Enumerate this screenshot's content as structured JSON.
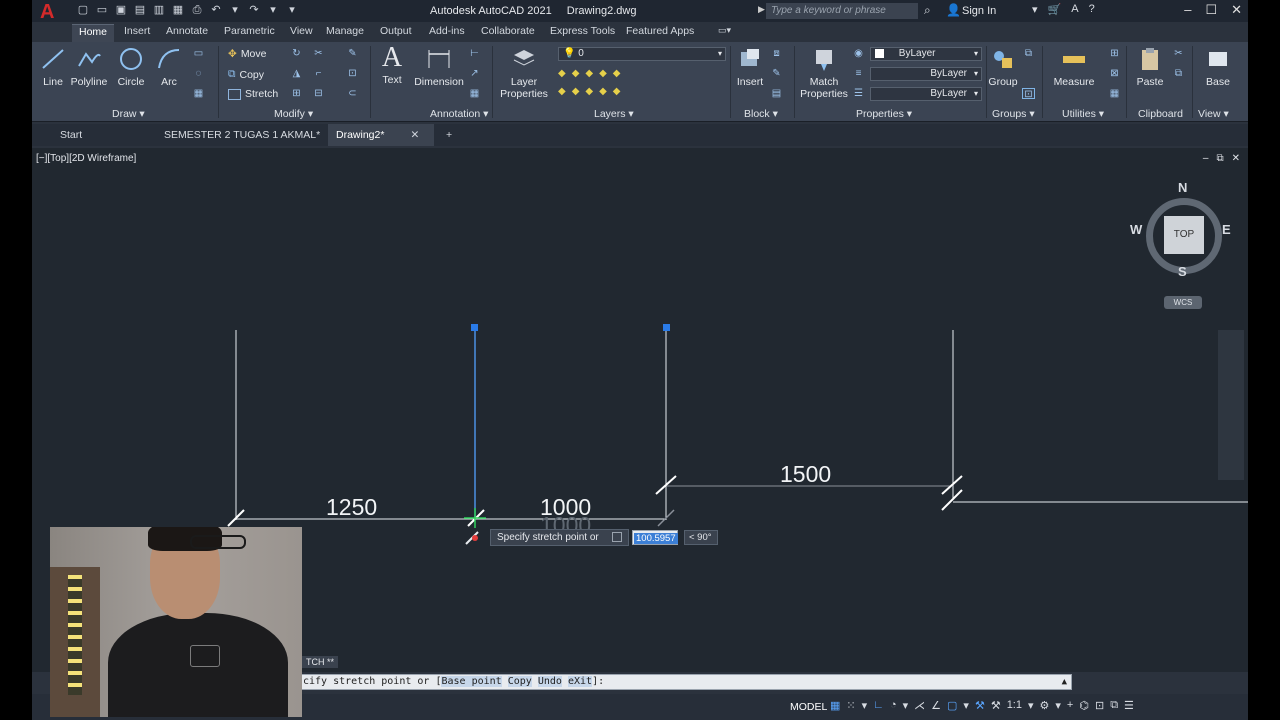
{
  "titlebar": {
    "app_name": "Autodesk AutoCAD 2021",
    "file_name": "Drawing2.dwg",
    "search_placeholder": "Type a keyword or phrase",
    "signin": "Sign In"
  },
  "ribbon_tabs": [
    "Home",
    "Insert",
    "Annotate",
    "Parametric",
    "View",
    "Manage",
    "Output",
    "Add-ins",
    "Collaborate",
    "Express Tools",
    "Featured Apps"
  ],
  "draw_panel": {
    "title": "Draw",
    "line": "Line",
    "polyline": "Polyline",
    "circle": "Circle",
    "arc": "Arc"
  },
  "modify_panel": {
    "title": "Modify",
    "move": "Move",
    "copy": "Copy",
    "stretch": "Stretch"
  },
  "annotation_panel": {
    "title": "Annotation",
    "text": "Text",
    "dimension": "Dimension"
  },
  "layers_panel": {
    "title": "Layers",
    "layer_properties_1": "Layer",
    "layer_properties_2": "Properties",
    "layer_value": "0"
  },
  "block_panel": {
    "title": "Block",
    "insert": "Insert"
  },
  "properties_panel": {
    "title": "Properties",
    "match_1": "Match",
    "match_2": "Properties",
    "color": "ByLayer",
    "linetype": "ByLayer",
    "lineweight": "ByLayer"
  },
  "groups_panel": {
    "title": "Groups",
    "group": "Group"
  },
  "utilities_panel": {
    "title": "Utilities",
    "measure": "Measure"
  },
  "clipboard_panel": {
    "title": "Clipboard",
    "paste": "Paste"
  },
  "view_panel": {
    "title": "View",
    "base": "Base"
  },
  "doc_tabs": {
    "start": "Start",
    "tab1": "SEMESTER 2 TUGAS 1 AKMAL*",
    "tab2": "Drawing2*"
  },
  "viewport": {
    "label": "[−][Top][2D Wireframe]",
    "viewcube_top": "TOP",
    "compass_n": "N",
    "compass_s": "S",
    "compass_e": "E",
    "compass_w": "W",
    "wcs": "WCS"
  },
  "dimensions": {
    "d1": "1250",
    "d2": "1000",
    "d3": "1500",
    "d2_ghost": "1000"
  },
  "dynamic_input": {
    "prompt": "Specify stretch point or",
    "value": "100.5957",
    "angle": "< 90°"
  },
  "command": {
    "history": "TCH **",
    "line_prefix": "cify stretch point or [",
    "opt_base": "Base point",
    "opt_copy": "Copy",
    "opt_undo": "Undo",
    "opt_exit": "eXit",
    "line_suffix": "]:"
  },
  "statusbar": {
    "model": "MODEL",
    "scale": "1:1"
  },
  "colors": {
    "accent": "#3c7fd6",
    "canvas": "#212830",
    "ribbon": "#3b4453",
    "grip": "#2a7be8"
  }
}
